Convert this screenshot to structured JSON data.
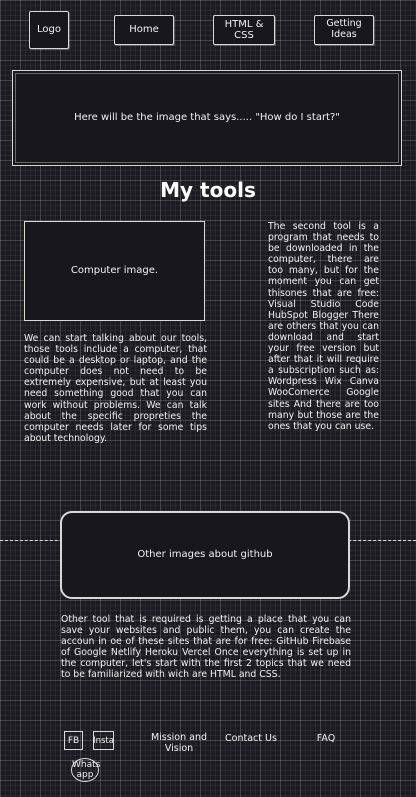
{
  "nav": {
    "logo": "Logo",
    "home": "Home",
    "html_css": "HTML & CSS",
    "getting_ideas": "Getting Ideas"
  },
  "hero": {
    "image_text": "Here will be the image that says.....   \"How do I start?\""
  },
  "main": {
    "title": "My tools",
    "computer_image_text": "Computer image.",
    "left_paragraph": "We can start talking about our tools, those tools include a computer, that could be a desktop or laptop, and the computer does not need to be extremely expensive, but at least you need something good that you can work without problems. We can talk about the specific propreties the computer needs later for some tips about technology.",
    "right_paragraph": "The second tool is a program that needs to be downloaded in the computer, there are too many, but for the moment you can get thisones that are free: Visual Studio Code HubSpot Blogger There are others that you can download and start your free version but after that it will require a subscription such as: Wordpress Wix Canva WooComerce Google sites And there are too many but those are the ones that you can use.",
    "github_image_text": "Other images about github",
    "bottom_paragraph": "Other tool that is required is getting a place that you can save your websites and public them, you can create the accoun in oe of these sites that are for free: GitHub Firebase of Google Netlify Heroku Vercel Once everything is set up in the computer, let's start with the first 2 topics that we need to be familiarized with wich are HTML and CSS."
  },
  "footer": {
    "fb": "FB",
    "insta": "Insta",
    "whatsapp": "Whats app",
    "mission": "Mission and Vision",
    "contact": "Contact Us",
    "faq": "FAQ"
  }
}
